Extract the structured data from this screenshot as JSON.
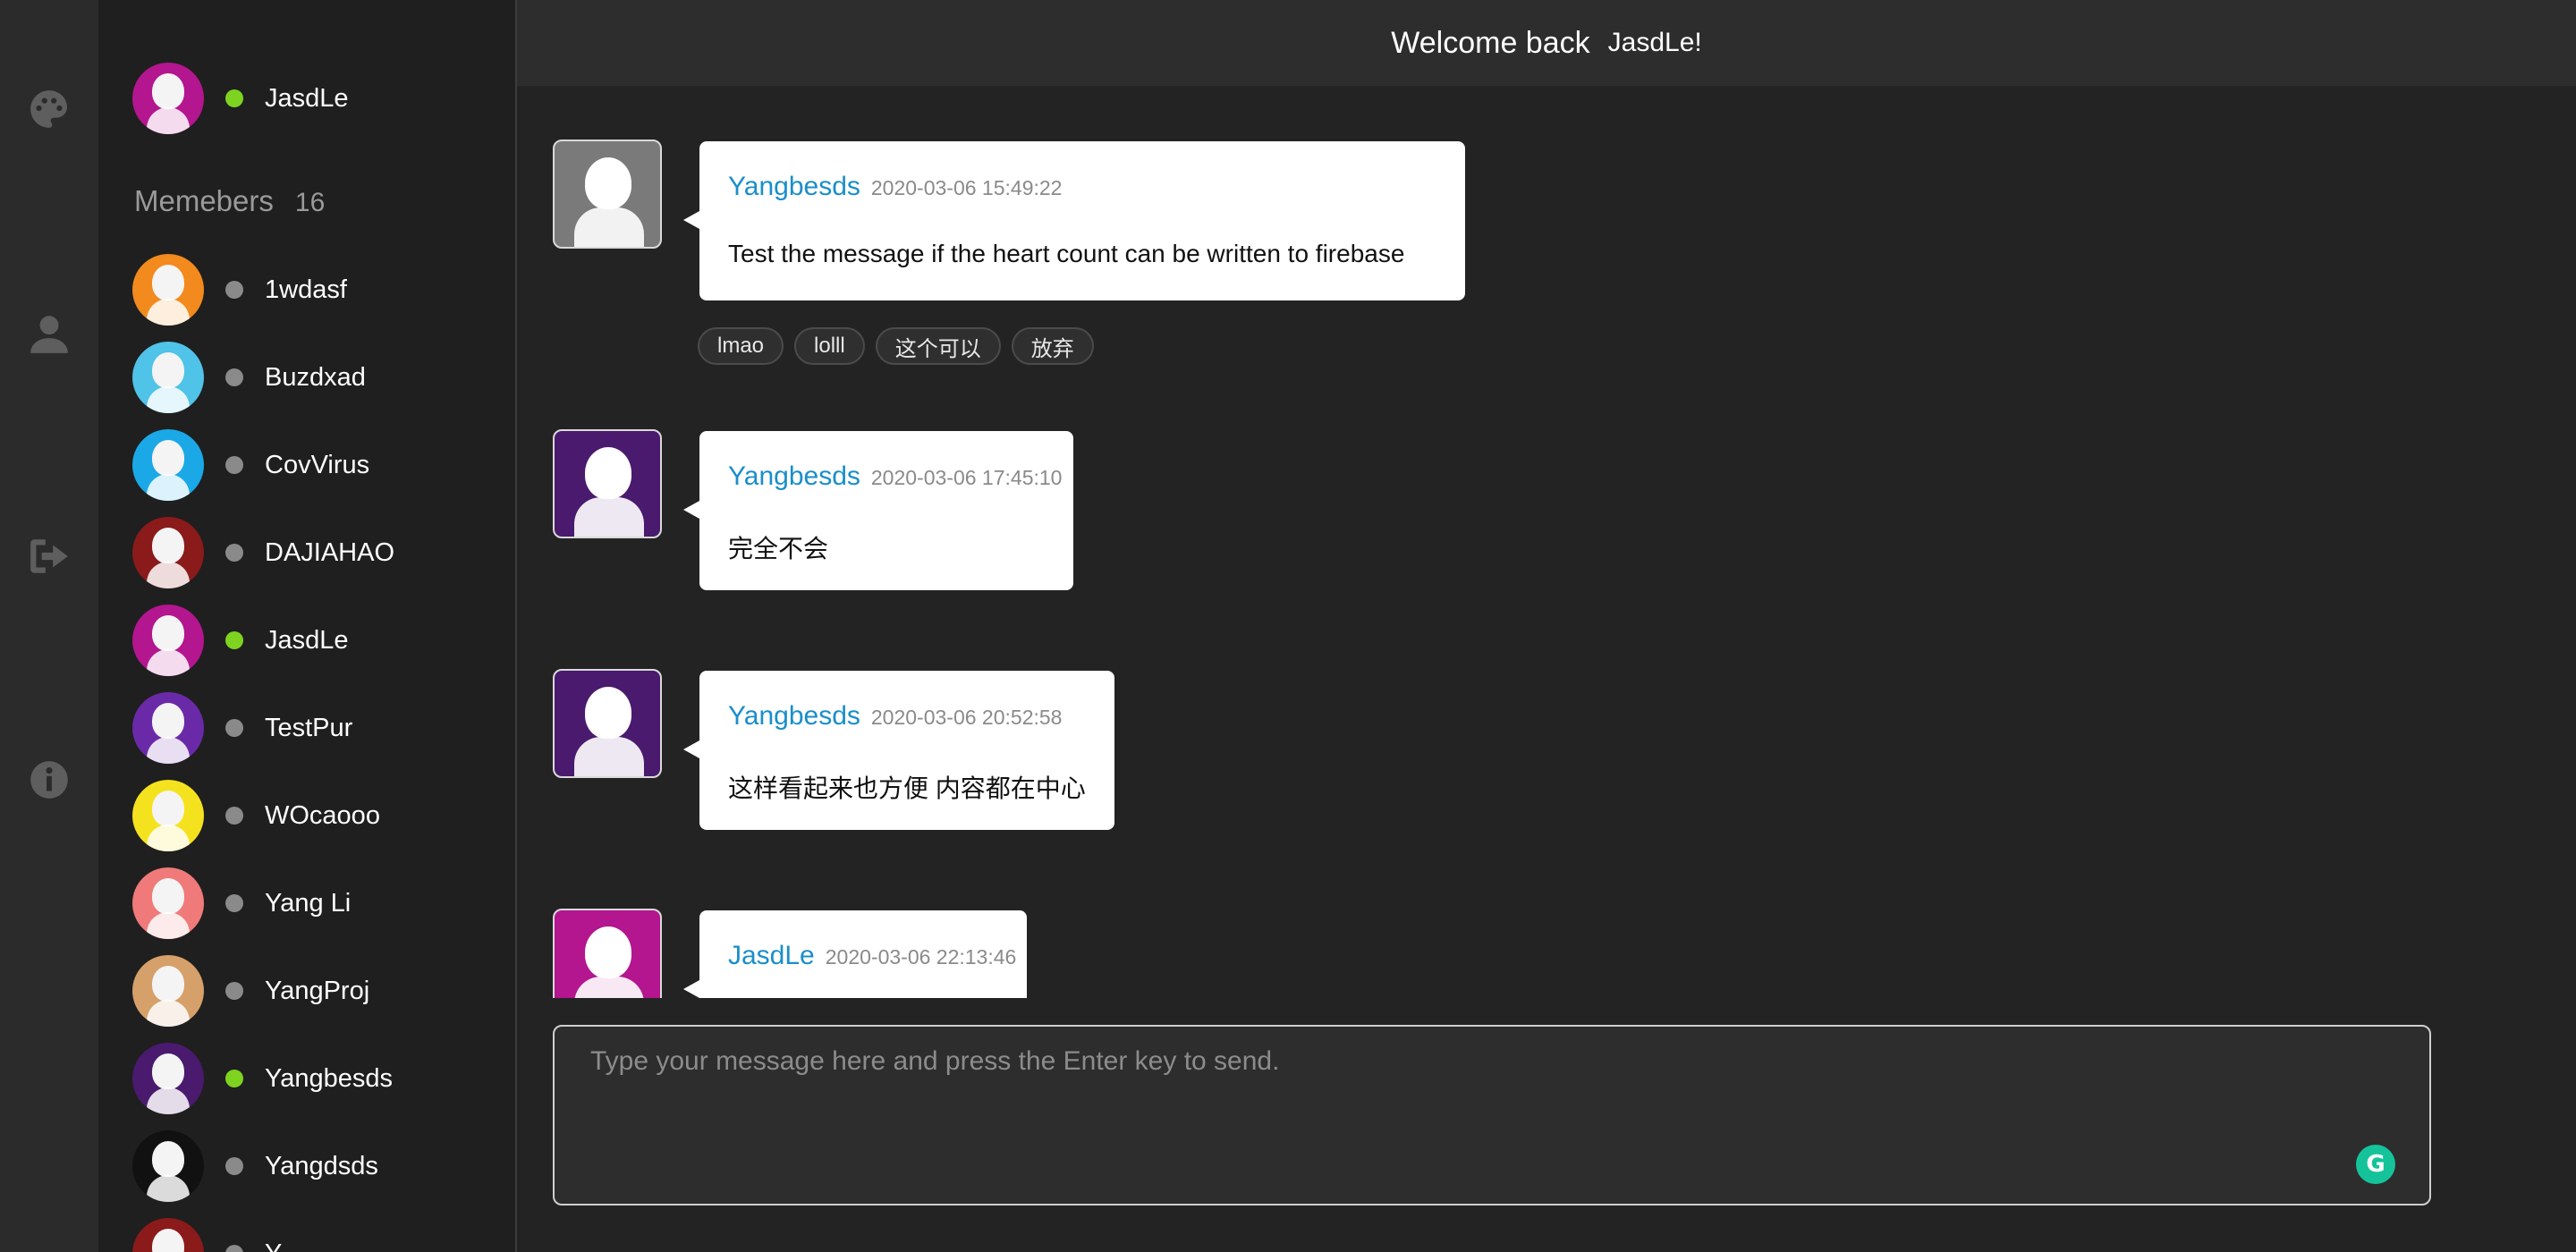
{
  "nav": {
    "items": [
      {
        "icon": "palette-icon"
      },
      {
        "icon": "user-icon"
      },
      {
        "icon": "sign-out-icon"
      },
      {
        "icon": "info-icon"
      }
    ]
  },
  "current_user": {
    "name": "JasdLe",
    "online": true,
    "avatar_color": "#b3168f"
  },
  "members": {
    "title": "Memebers",
    "count": "16",
    "list": [
      {
        "name": "1wdasf",
        "online": false,
        "avatar_color": "#f28a1e"
      },
      {
        "name": "Buzdxad",
        "online": false,
        "avatar_color": "#4fc3e8"
      },
      {
        "name": "CovVirus",
        "online": false,
        "avatar_color": "#1aa9e6"
      },
      {
        "name": "DAJIAHAO",
        "online": false,
        "avatar_color": "#8b1a1a"
      },
      {
        "name": "JasdLe",
        "online": true,
        "avatar_color": "#b3168f"
      },
      {
        "name": "TestPur",
        "online": false,
        "avatar_color": "#6a2aa8"
      },
      {
        "name": "WOcaooo",
        "online": false,
        "avatar_color": "#f5e21e"
      },
      {
        "name": "Yang Li",
        "online": false,
        "avatar_color": "#f07a7a"
      },
      {
        "name": "YangProj",
        "online": false,
        "avatar_color": "#d6a06a"
      },
      {
        "name": "Yangbesds",
        "online": true,
        "avatar_color": "#4a1a6e"
      },
      {
        "name": "Yangdsds",
        "online": false,
        "avatar_color": "#111111"
      },
      {
        "name": "Y...",
        "online": false,
        "avatar_color": "#8b1a1a"
      }
    ]
  },
  "header": {
    "welcome": "Welcome back",
    "user": "JasdLe!"
  },
  "messages": [
    {
      "user": "Yangbesds",
      "time": "2020-03-06 15:49:22",
      "text": "Test the message if the heart count can be written to firebase",
      "avatar_color": "#7a7a7a",
      "reactions": [
        "lmao",
        "lolll",
        "这个可以",
        "放弃"
      ]
    },
    {
      "user": "Yangbesds",
      "time": "2020-03-06 17:45:10",
      "text": "完全不会",
      "avatar_color": "#4a1a6e",
      "reactions": []
    },
    {
      "user": "Yangbesds",
      "time": "2020-03-06 20:52:58",
      "text": "这样看起来也方便 内容都在中心",
      "avatar_color": "#4a1a6e",
      "reactions": []
    },
    {
      "user": "JasdLe",
      "time": "2020-03-06 22:13:46",
      "text": "",
      "avatar_color": "#b3168f",
      "reactions": []
    }
  ],
  "composer": {
    "placeholder": "Type your message here and press the Enter key to send.",
    "value": ""
  },
  "colors": {
    "accent": "#1a8ec9",
    "online": "#7ed321",
    "offline": "#8a8a8a",
    "grammarly": "#15c39a"
  }
}
